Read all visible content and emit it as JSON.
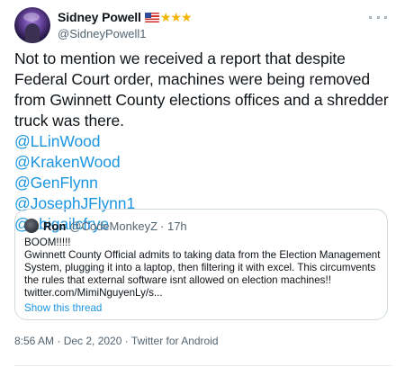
{
  "author": {
    "display_name": "Sidney Powell",
    "handle": "@SidneyPowell1",
    "flag_icon": "us-flag-icon",
    "stars": "★★★",
    "star_color": "#f4b400"
  },
  "tweet": {
    "text": "Not to mention we received a report that despite Federal Court order, machines were being removed from Gwinnett County elections offices and a shredder truck was there.",
    "mentions": [
      "@LLinWood",
      "@KrakenWood",
      "@GenFlynn",
      "@JosephJFlynn1",
      "@abigailcfrye"
    ],
    "link_color": "#1b95e0"
  },
  "quote": {
    "display_name": "Ron",
    "handle": "@CodeMonkeyZ",
    "time": "· 17h",
    "text": "BOOM!!!!!\nGwinnett County Official admits to taking data from the Election Management System, plugging it into a laptop, then filtering it with excel. This circumvents the rules that external software isnt allowed on election machines!! twitter.com/MimiNguyenLy/s...",
    "show_thread": "Show this thread"
  },
  "meta": {
    "timestamp": "8:56 AM · Dec 2, 2020 · Twitter for Android"
  },
  "menu": {
    "icon": "more-options-icon"
  }
}
